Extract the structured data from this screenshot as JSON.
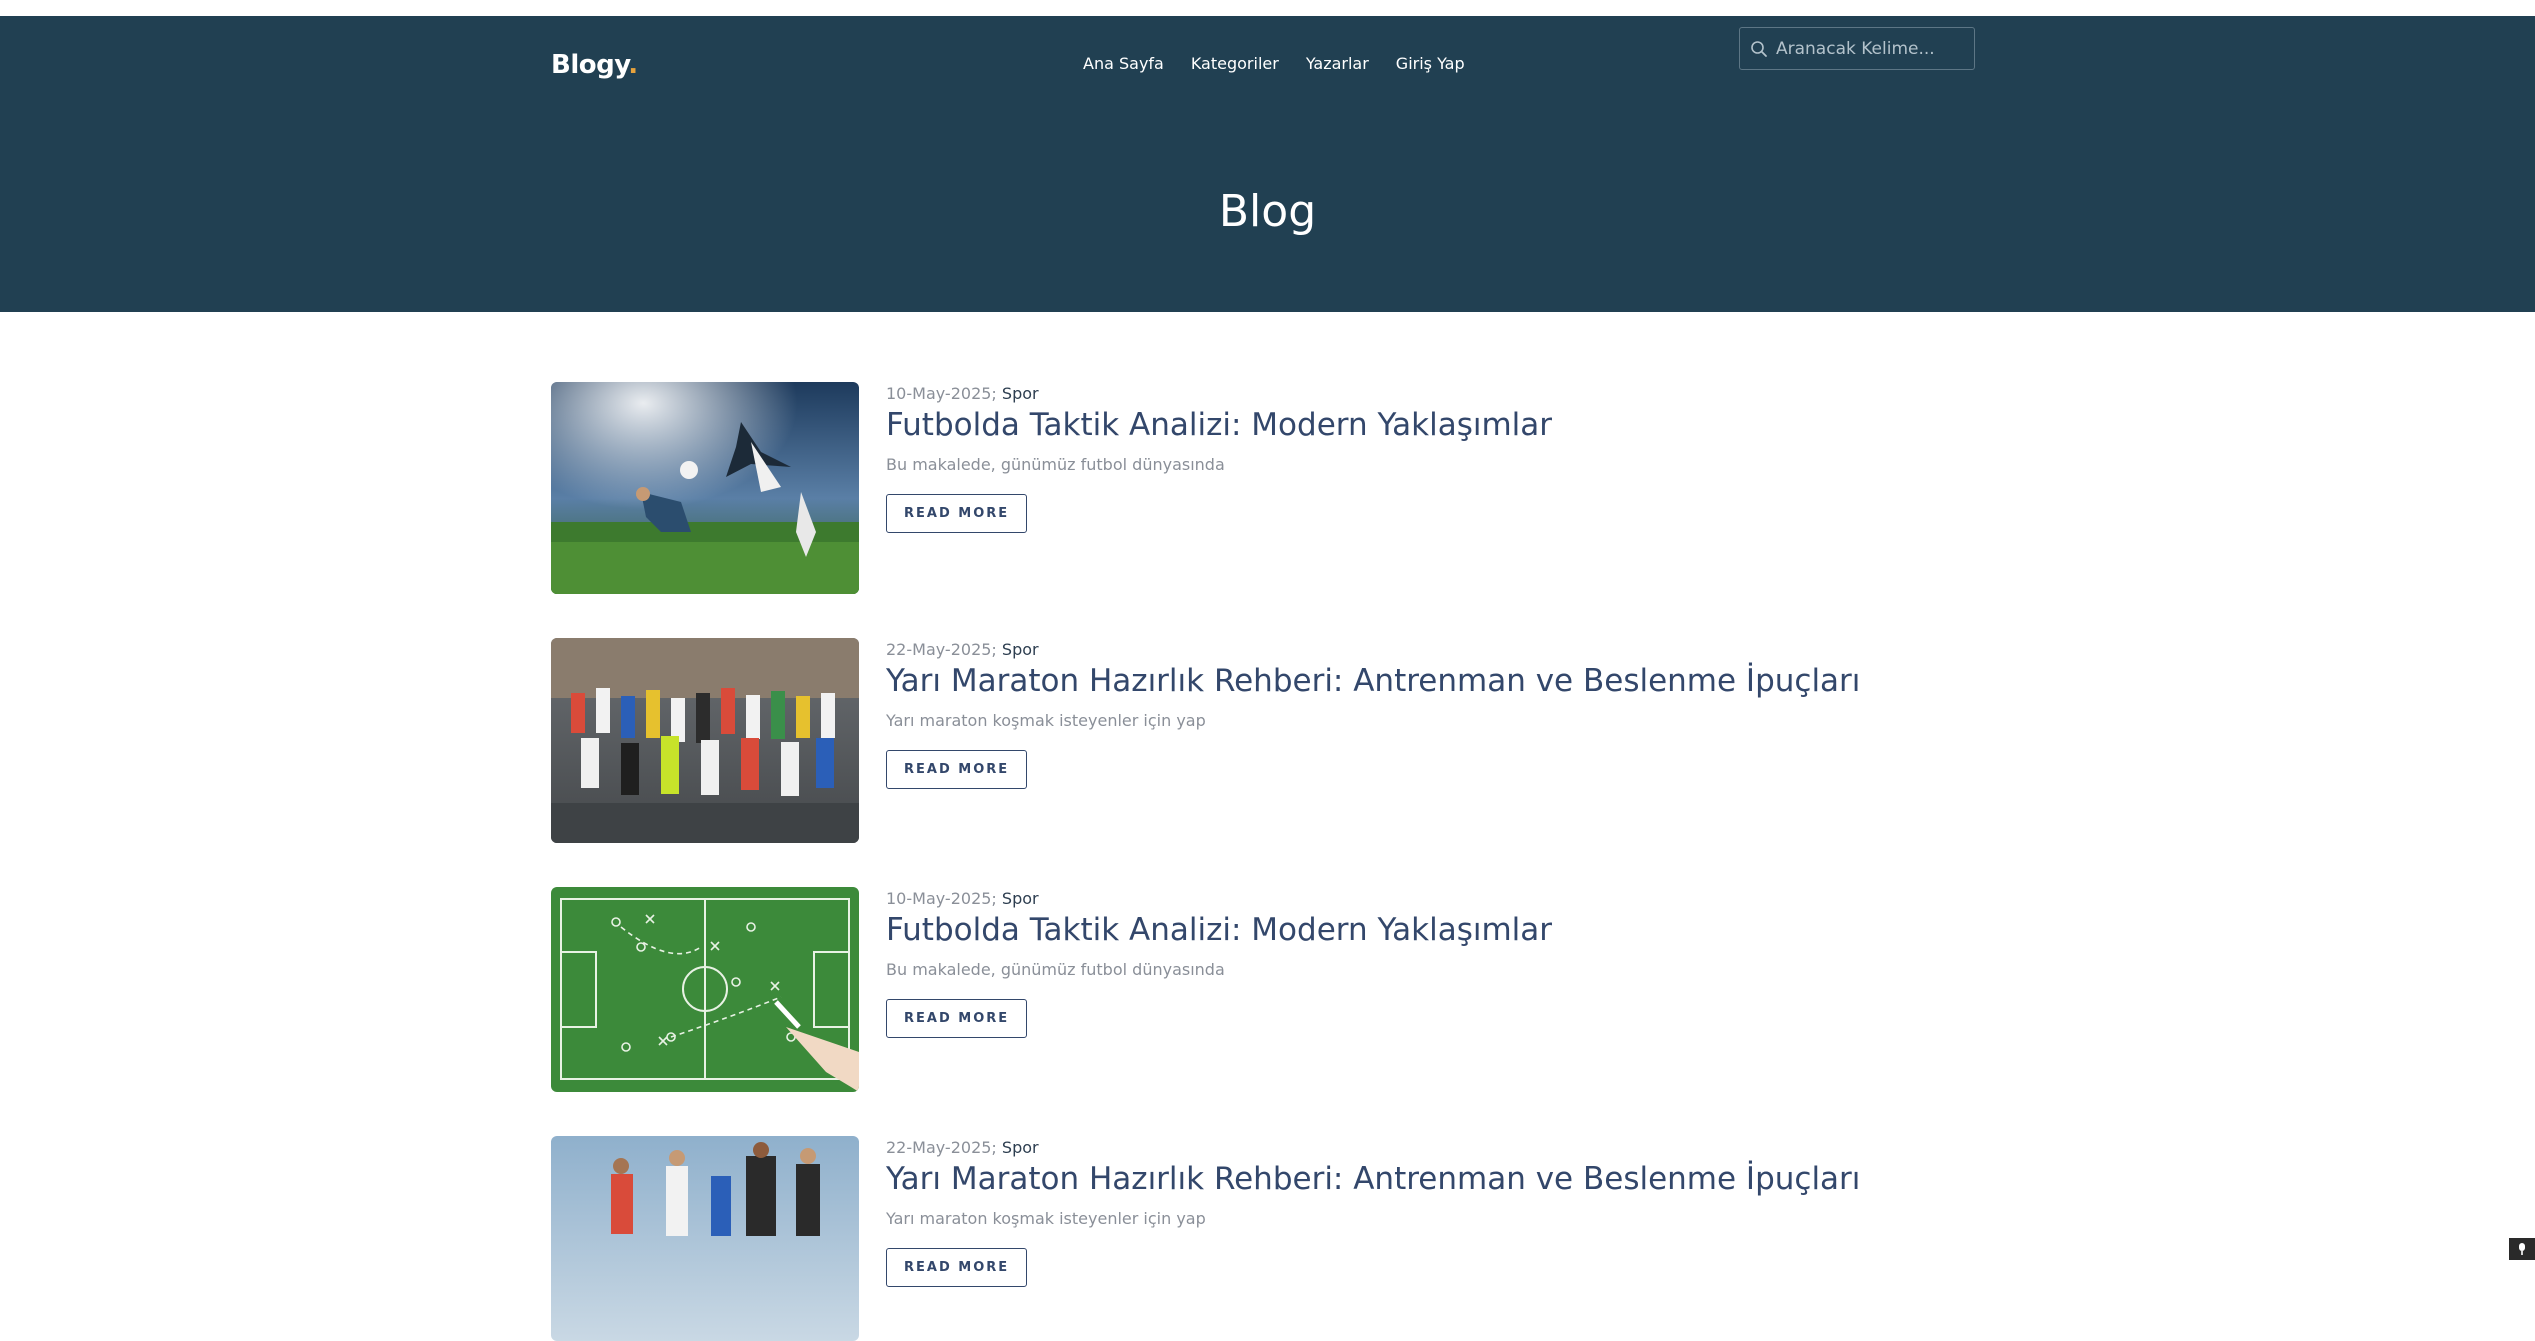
{
  "brand": {
    "name": "Blogy",
    "dot": "."
  },
  "nav": {
    "items": [
      {
        "label": "Ana Sayfa"
      },
      {
        "label": "Kategoriler"
      },
      {
        "label": "Yazarlar"
      },
      {
        "label": "Giriş Yap"
      }
    ]
  },
  "search": {
    "placeholder": "Aranacak Kelime..."
  },
  "hero": {
    "title": "Blog"
  },
  "posts": [
    {
      "date": "10-May-2025;",
      "category": "Spor",
      "title": "Futbolda Taktik Analizi: Modern Yaklaşımlar",
      "excerpt": "Bu makalede, günümüz futbol dünyasında",
      "button": "READ MORE",
      "image": "football-stadium-action"
    },
    {
      "date": "22-May-2025;",
      "category": "Spor",
      "title": "Yarı Maraton Hazırlık Rehberi: Antrenman ve Beslenme İpuçları",
      "excerpt": "Yarı maraton koşmak isteyenler için yap",
      "button": "READ MORE",
      "image": "marathon-runners-crowd"
    },
    {
      "date": "10-May-2025;",
      "category": "Spor",
      "title": "Futbolda Taktik Analizi: Modern Yaklaşımlar",
      "excerpt": "Bu makalede, günümüz futbol dünyasında",
      "button": "READ MORE",
      "image": "tactics-chalkboard"
    },
    {
      "date": "22-May-2025;",
      "category": "Spor",
      "title": "Yarı Maraton Hazırlık Rehberi: Antrenman ve Beslenme İpuçları",
      "excerpt": "Yarı maraton koşmak isteyenler için yap",
      "button": "READ MORE",
      "image": "runners-sky"
    }
  ],
  "colors": {
    "header_bg": "#214052",
    "title": "#33476b",
    "muted": "#8a8f98",
    "brand_dot": "#e8a33c"
  }
}
